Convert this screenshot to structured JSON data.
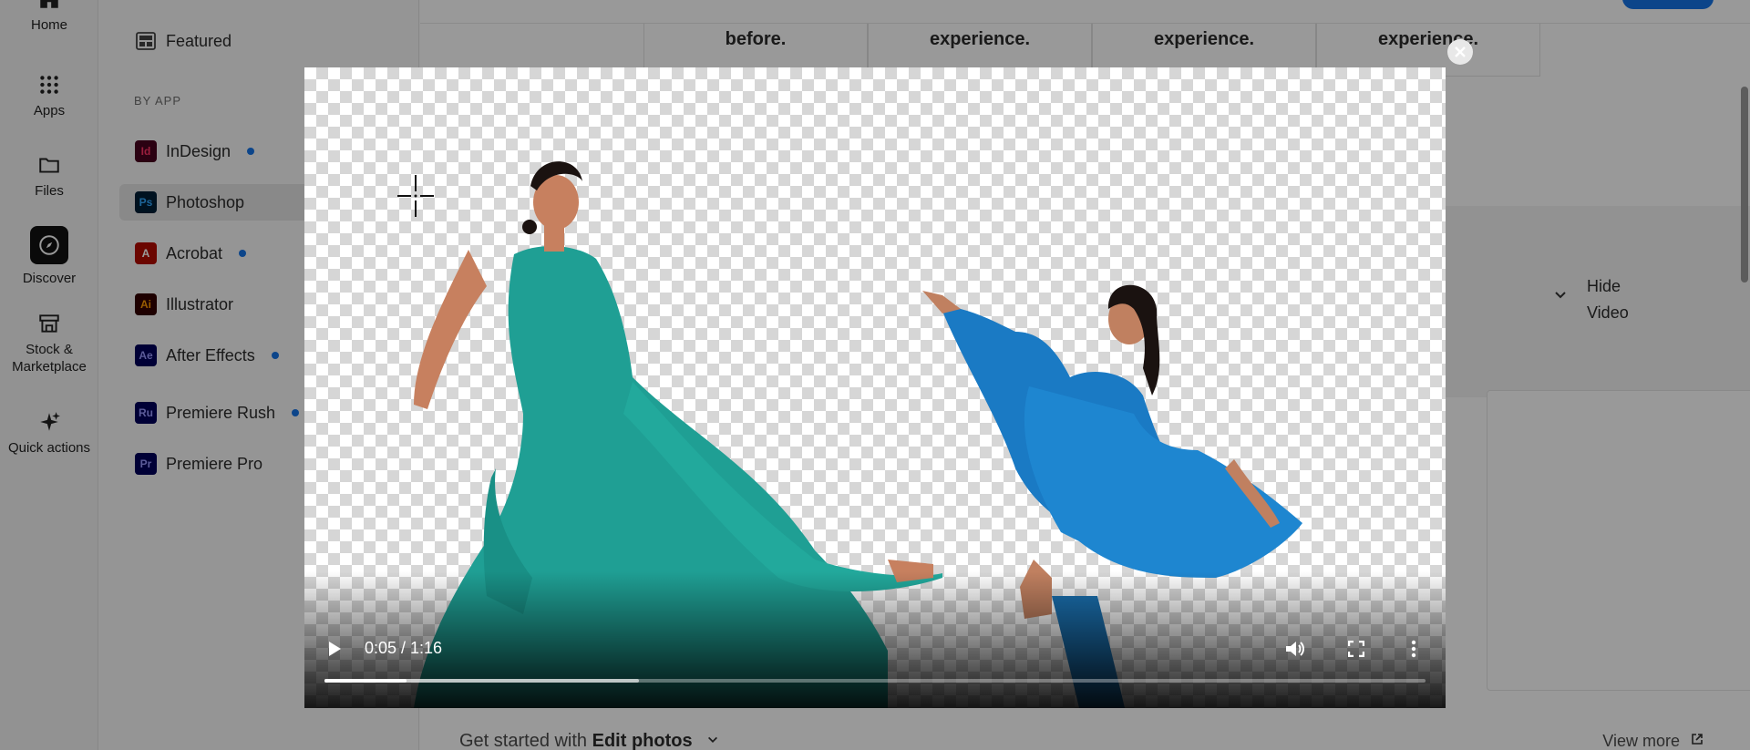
{
  "rail": {
    "items": [
      {
        "label": "Home",
        "icon": "home-icon"
      },
      {
        "label": "Apps",
        "icon": "apps-grid-icon"
      },
      {
        "label": "Files",
        "icon": "folder-icon"
      },
      {
        "label": "Discover",
        "icon": "compass-icon"
      },
      {
        "label": "Stock &\nMarketplace",
        "label_line1": "Stock &",
        "label_line2": "Marketplace",
        "icon": "store-icon"
      },
      {
        "label": "Quick actions",
        "icon": "sparkle-icon"
      }
    ]
  },
  "sidebar": {
    "featured_label": "Featured",
    "section_by_app": "BY APP",
    "apps": [
      {
        "label": "InDesign",
        "abbr": "Id",
        "color": "#49021f",
        "fg": "#ff3366",
        "dot": true
      },
      {
        "label": "Photoshop",
        "abbr": "Ps",
        "color": "#001e36",
        "fg": "#31a8ff",
        "dot": false,
        "active": true
      },
      {
        "label": "Acrobat",
        "abbr": "A",
        "color": "#b30b00",
        "fg": "#ffffff",
        "dot": true
      },
      {
        "label": "Illustrator",
        "abbr": "Ai",
        "color": "#330000",
        "fg": "#ff9a00",
        "dot": false
      },
      {
        "label": "After Effects",
        "abbr": "Ae",
        "color": "#00005b",
        "fg": "#9999ff",
        "dot": true
      },
      {
        "label": "Premiere Rush",
        "abbr": "Ru",
        "color": "#00005b",
        "fg": "#9999ff",
        "dot": true
      },
      {
        "label": "Premiere Pro",
        "abbr": "Pr",
        "color": "#00005b",
        "fg": "#9999ff",
        "dot": false
      }
    ]
  },
  "main": {
    "cards": [
      "before.",
      "experience.",
      "experience.",
      "experience."
    ],
    "hide_video_line1": "Hide",
    "hide_video_line2": "Video",
    "footer_prefix": "Get started with",
    "footer_bold": "Edit photos",
    "view_more": "View more"
  },
  "video": {
    "time": "0:05 / 1:16",
    "played_fraction": 0.0746,
    "buffered_fraction": 0.286,
    "controls": [
      "play-icon",
      "volume-icon",
      "fullscreen-icon",
      "more-options-icon"
    ]
  },
  "colors": {
    "accent": "#1473e6",
    "overlay": "rgba(0,0,0,0.40)"
  }
}
